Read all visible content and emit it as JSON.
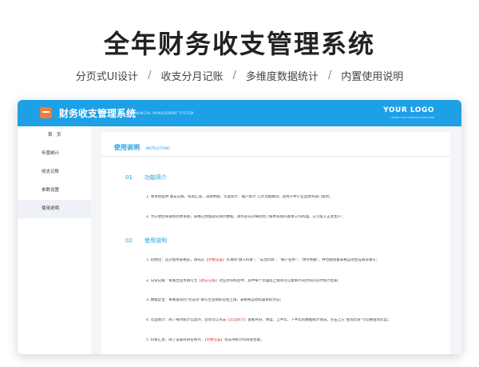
{
  "hero": {
    "title": "全年财务收支管理系统",
    "features": [
      "分页式UI设计",
      "收支分月记账",
      "多维度数据统计",
      "内置使用说明"
    ],
    "separator": "/"
  },
  "header": {
    "app_title": "财务收支管理系统",
    "app_subtitle": "FINANCIAL MANAGEMENT SYSTEM",
    "brand": "YOUR LOGO",
    "brand_sub": "ENTER YOUR COMPANY NAME HERE"
  },
  "sidebar": {
    "items": [
      {
        "label": "首　页",
        "active": false
      },
      {
        "label": "年度统计",
        "active": false
      },
      {
        "label": "收支记账",
        "active": false
      },
      {
        "label": "参数设置",
        "active": false
      },
      {
        "label": "使用说明",
        "active": true
      }
    ]
  },
  "content": {
    "title": "使用说明",
    "title_en": "INSTRUCTIONS",
    "sections": [
      {
        "num": "01",
        "heading": "功能简介"
      },
      {
        "num": "02",
        "heading": "使用说明"
      }
    ],
    "intro": [
      "1. 本系统提供 收支记账、科目汇总、派财余额、年度统计、账户统计 几大功能模块，适用于中小企业财务部门使用；",
      "2. 为方便您快速熟悉本系统，表格已预留部分演示数据，请务必先仔细试用了解本系统的基本工作机理，方可投入正式生产；"
    ],
    "usage": [
      {
        "pre": "1. 初始化：首次使用表格前，请先在",
        "hl": "【参数设置】",
        "post": "页清除\"收入科目\"、\"支出科目\"、\"账户名称\"、\"预付余额\"，并也能接着表格自动生成请求填写；"
      },
      {
        "pre": "2. 日常记账：将发出业务填写至",
        "hl": "【收支记账】",
        "post": "对应月份标签中，其中每个页面底上角有可以复制不同月份的实时统计结束；"
      },
      {
        "pre": "3. 数据定位：将要查询的\"凭证号\"填写至证明标签右上角，表格将自动标题目标凭证；",
        "hl": "",
        "post": ""
      },
      {
        "pre": "4. 年度统计：除了每月统计信息外，您也可以点击",
        "hl": "【年度统计】",
        "post": "查看月份、季度、上半年、下半年的数据统计情况，点击上方\"查询年份\"可切换查询年度；"
      },
      {
        "pre": "5. 科目汇总：除了设置科目名称外，",
        "hl": "【参数设置】",
        "post": "也支持统计科目发生额；"
      }
    ]
  }
}
